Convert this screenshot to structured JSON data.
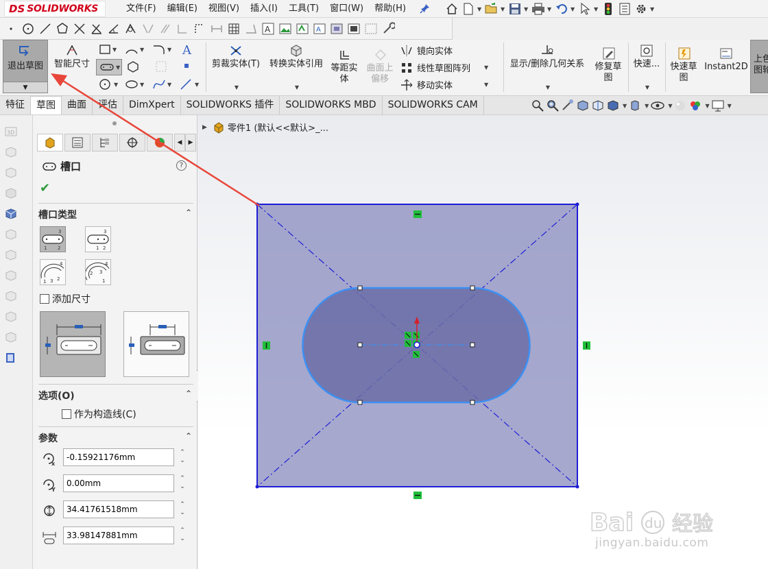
{
  "app": {
    "brand_ds": "DS",
    "brand_name": "SOLIDWORKS"
  },
  "menu": [
    "文件(F)",
    "编辑(E)",
    "视图(V)",
    "插入(I)",
    "工具(T)",
    "窗口(W)",
    "帮助(H)"
  ],
  "ribbon": {
    "exit_sketch": "退出草图",
    "smart_dimension": "智能尺寸",
    "trim": "剪裁实体(T)",
    "convert": "转换实体引用",
    "offset": "等距实体",
    "offset_surface": "曲面上偏移",
    "mirror": "镜向实体",
    "linear_pattern": "线性草图阵列",
    "move": "移动实体",
    "display_relations": "显示/删除几何关系",
    "repair": "修复草图",
    "quick_snap": "快速...",
    "rapid_sketch": "快速草图",
    "instant2d": "Instant2D",
    "shaded": "上色草图轮廓"
  },
  "tabs": [
    "特征",
    "草图",
    "曲面",
    "评估",
    "DimXpert",
    "SOLIDWORKS 插件",
    "SOLIDWORKS MBD",
    "SOLIDWORKS CAM"
  ],
  "active_tab_index": 1,
  "property_manager": {
    "title": "槽口",
    "help": "?",
    "slot_type_header": "槽口类型",
    "add_dimension_label": "添加尺寸",
    "options_header": "选项(O)",
    "construction_label": "作为构造线(C)",
    "params_header": "参数",
    "params": [
      {
        "name": "center-x",
        "value": "-0.15921176mm"
      },
      {
        "name": "center-y",
        "value": "0.00mm"
      },
      {
        "name": "slot-width",
        "value": "34.41761518mm"
      },
      {
        "name": "slot-length",
        "value": "33.98147881mm"
      }
    ]
  },
  "tree": {
    "label": "零件1  (默认<<默认>_..."
  },
  "watermark": {
    "text": "jingyan.baidu.com"
  },
  "colors": {
    "accent_red": "#d0021b",
    "sketch_fill": "#8d8fc0",
    "sketch_edge": "#1d1dd6",
    "slot_fill": "#6b6da6",
    "slot_edge": "#3d8ff2",
    "relation_green": "#1fbf3a",
    "annotation_arrow": "#e8463a"
  }
}
